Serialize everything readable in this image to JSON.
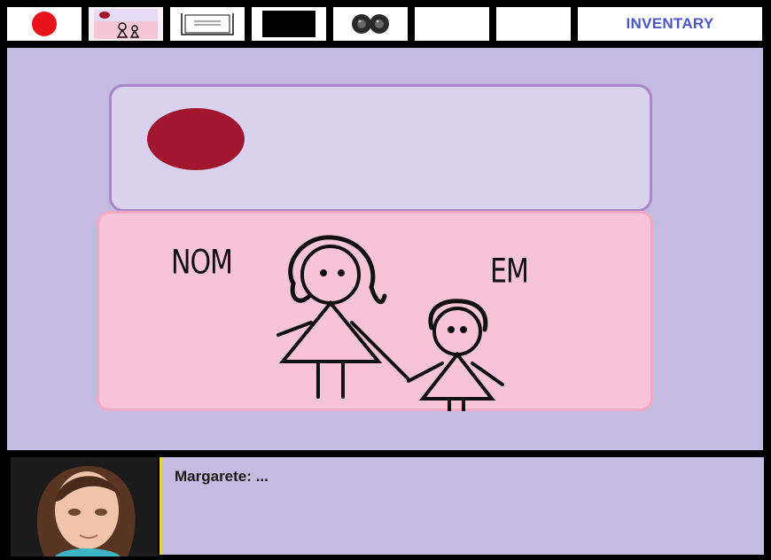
{
  "inventory": {
    "slots": [
      {
        "item": "red-ball-icon"
      },
      {
        "item": "drawing-card-thumbnail-icon"
      },
      {
        "item": "paper-note-icon"
      },
      {
        "item": "black-rectangle-icon"
      },
      {
        "item": "goggles-icon"
      },
      {
        "item": "empty"
      },
      {
        "item": "empty"
      }
    ],
    "button_label": "INVENTARY"
  },
  "scene": {
    "card": {
      "label_left": "NOM",
      "label_right": "EM"
    }
  },
  "dialogue": {
    "line": "Margarete: ..."
  },
  "colors": {
    "scene_bg": "#c4bbe0",
    "card_top": "#d9d2ef",
    "card_bottom": "#f6c4d6",
    "seal": "#a0172f",
    "inventory_text": "#4a55c8"
  }
}
